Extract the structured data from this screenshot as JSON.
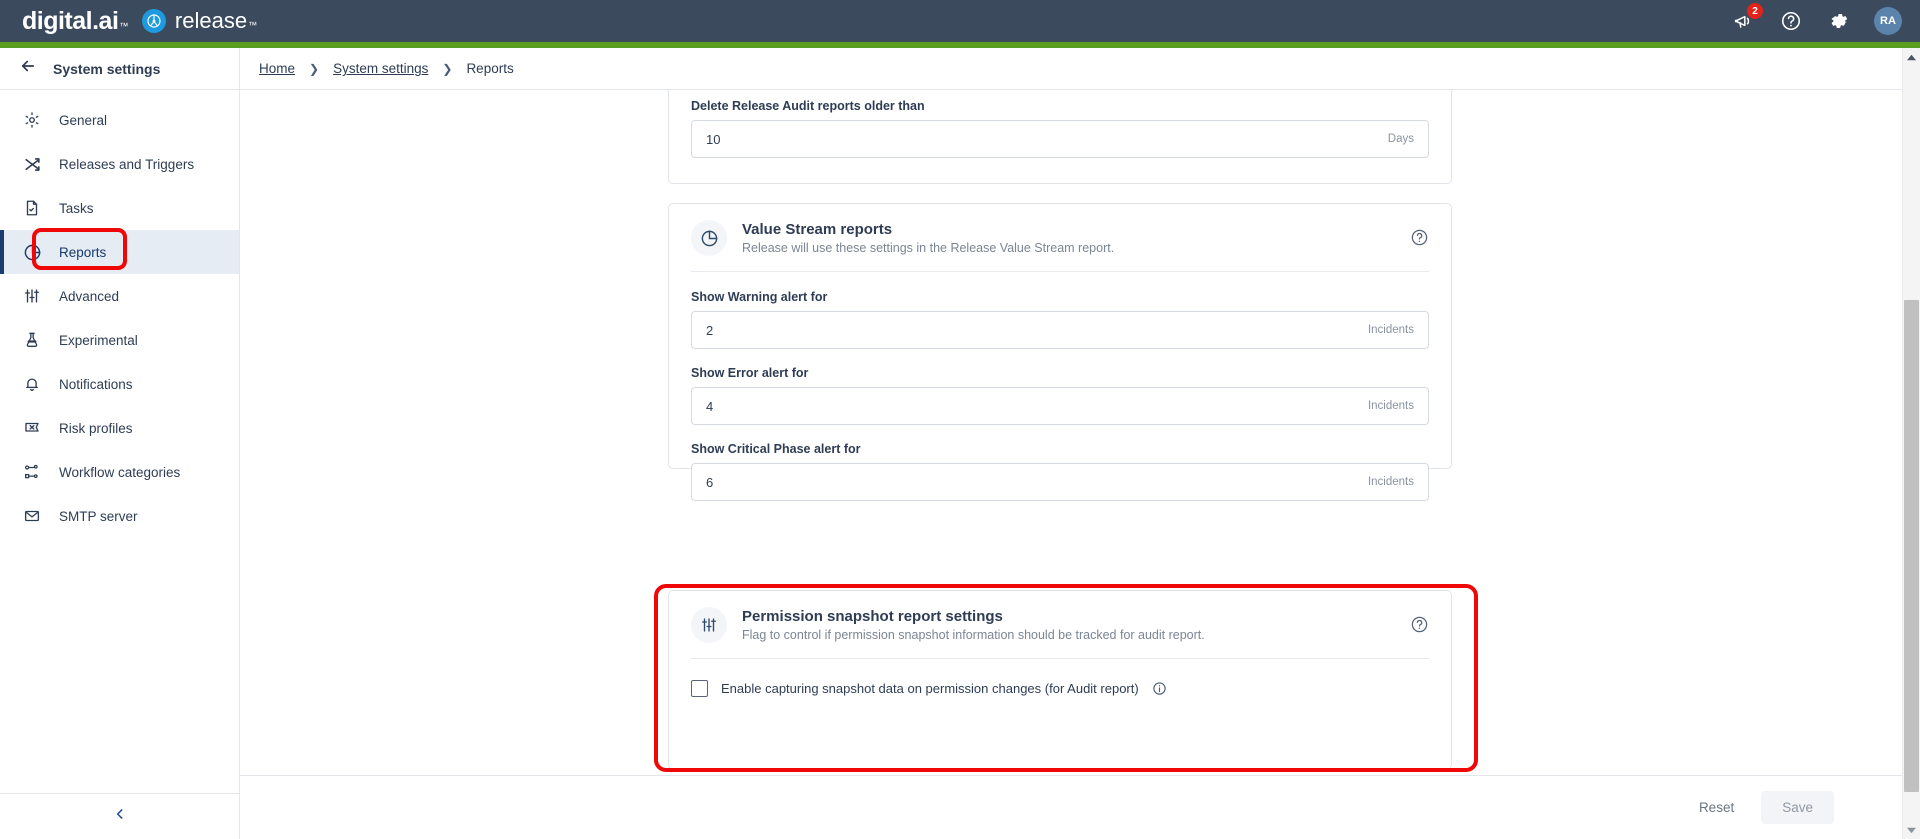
{
  "header": {
    "brand_primary": "digital.ai",
    "brand_primary_tm": "™",
    "brand_secondary": "release",
    "brand_secondary_tm": "™",
    "notifications_badge": "2",
    "notifications_icon": "megaphone-icon",
    "help_icon": "question-circle-icon",
    "settings_icon": "gear-icon",
    "avatar_initials": "RA",
    "bar_color": "#3c4a5e",
    "accent_color": "#5a9e1f"
  },
  "sidebar": {
    "title": "System settings",
    "back_icon": "arrow-left-icon",
    "collapse_icon": "chevron-left-icon",
    "items": [
      {
        "label": "General",
        "icon": "gear-icon",
        "active": false
      },
      {
        "label": "Releases and Triggers",
        "icon": "shuffle-icon",
        "active": false
      },
      {
        "label": "Tasks",
        "icon": "file-check-icon",
        "active": false
      },
      {
        "label": "Reports",
        "icon": "pie-chart-icon",
        "active": true
      },
      {
        "label": "Advanced",
        "icon": "sliders-icon",
        "active": false
      },
      {
        "label": "Experimental",
        "icon": "flask-icon",
        "active": false
      },
      {
        "label": "Notifications",
        "icon": "bell-icon",
        "active": false
      },
      {
        "label": "Risk profiles",
        "icon": "risk-flag-icon",
        "active": false
      },
      {
        "label": "Workflow categories",
        "icon": "workflow-nodes-icon",
        "active": false
      },
      {
        "label": "SMTP server",
        "icon": "envelope-icon",
        "active": false
      }
    ]
  },
  "breadcrumb": {
    "items": [
      {
        "label": "Home",
        "is_link": true
      },
      {
        "label": "System settings",
        "is_link": true
      },
      {
        "label": "Reports",
        "is_link": false
      }
    ],
    "separator": "❯"
  },
  "main": {
    "audit_card": {
      "field_label": "Delete Release Audit reports older than",
      "field_value": "10",
      "field_suffix": "Days",
      "field_placeholder": "10"
    },
    "value_stream_card": {
      "icon": "pie-chart-icon",
      "title": "Value Stream reports",
      "subtitle": "Release will use these settings in the Release Value Stream report.",
      "help_icon": "question-circle-icon",
      "fields": [
        {
          "label": "Show Warning alert for",
          "value": "2",
          "suffix": "Incidents",
          "placeholder": "2"
        },
        {
          "label": "Show Error alert for",
          "value": "4",
          "suffix": "Incidents",
          "placeholder": "4"
        },
        {
          "label": "Show Critical Phase alert for",
          "value": "6",
          "suffix": "Incidents",
          "placeholder": "6"
        }
      ]
    },
    "permission_card": {
      "icon": "sliders-icon",
      "title": "Permission snapshot report settings",
      "subtitle": "Flag to control if permission snapshot information should be tracked for audit report.",
      "help_icon": "question-circle-icon",
      "checkbox_label": "Enable capturing snapshot data on permission changes (for Audit report)",
      "checkbox_checked": false,
      "checkbox_info_icon": "info-circle-icon"
    }
  },
  "footer": {
    "reset_label": "Reset",
    "save_label": "Save",
    "save_disabled": true
  },
  "scrollbar": {
    "up_icon": "caret-up-icon",
    "down_icon": "caret-down-icon"
  },
  "annotations": {
    "highlight_color": "#f00808",
    "count": 2
  }
}
